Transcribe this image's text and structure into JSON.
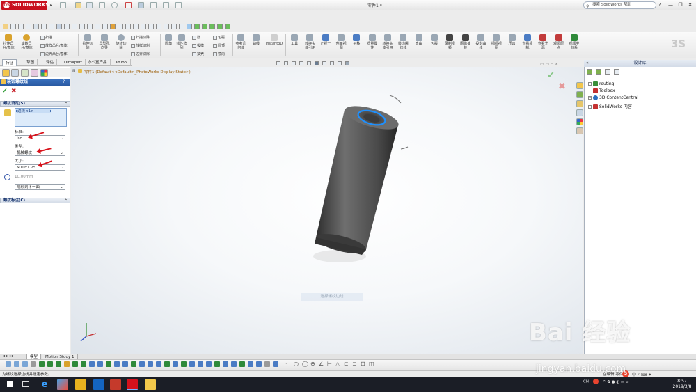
{
  "titlebar": {
    "app_logo": "SOLIDWORKS",
    "document_title": "零件1 *",
    "search_placeholder": "搜索 SolidWorks 帮助",
    "window_minimize": "—",
    "window_restore": "❐",
    "window_close": "✕"
  },
  "ribbon": {
    "group1": [
      {
        "label": "拉伸凸\n台/基体",
        "icon": "extrude-boss-icon",
        "color": "#d9a22c"
      },
      {
        "label": "旋转凸\n台/基体",
        "icon": "revolve-boss-icon",
        "color": "#d9a22c"
      }
    ],
    "group1_small": [
      "扫描",
      "放样凸台/基体",
      "边界凸台/基体"
    ],
    "group2": [
      {
        "label": "拉伸切\n除",
        "icon": "extrude-cut-icon",
        "color": "#9aa7b4"
      },
      {
        "label": "异型孔\n向导",
        "icon": "hole-wizard-icon",
        "color": "#9aa7b4"
      },
      {
        "label": "旋转切\n除",
        "icon": "revolve-cut-icon",
        "color": "#9aa7b4"
      }
    ],
    "group2_small": [
      "扫描切除",
      "放样切割",
      "边界切除"
    ],
    "group3": [
      {
        "label": "圆角",
        "icon": "fillet-icon",
        "color": "#9aa7b4"
      },
      {
        "label": "线性阵\n列",
        "icon": "linear-pattern-icon",
        "color": "#9aa7b4"
      }
    ],
    "group3_small": [
      "筋",
      "拔模",
      "抽壳",
      "包覆",
      "圆顶",
      "镜向"
    ],
    "group4": [
      {
        "label": "参考几\n何体",
        "icon": "reference-geometry-icon",
        "color": "#9aa7b4"
      },
      {
        "label": "曲线",
        "icon": "curves-icon",
        "color": "#9aa7b4"
      },
      {
        "label": "Instant3D",
        "icon": "instant3d-icon",
        "color": "#cfcfcf"
      }
    ],
    "group5": [
      {
        "label": "工具",
        "icon": "tools-icon",
        "color": "#9aa7b4"
      },
      {
        "label": "转换实\n体引用",
        "icon": "convert-entities-icon",
        "color": "#9aa7b4"
      },
      {
        "label": "正视于",
        "icon": "normal-to-icon",
        "color": "#4b7cc4"
      },
      {
        "label": "剖面视\n图",
        "icon": "section-view-icon",
        "color": "#9aa7b4"
      },
      {
        "label": "平移",
        "icon": "pan-icon",
        "color": "#4b7cc4"
      },
      {
        "label": "质量属\n性",
        "icon": "mass-properties-icon",
        "color": "#9aa7b4"
      },
      {
        "label": "转换实\n体引用",
        "icon": "convert-entities-2-icon",
        "color": "#9aa7b4"
      },
      {
        "label": "装饰螺\n纹线",
        "icon": "cosmetic-thread-icon",
        "color": "#9aa7b4"
      },
      {
        "label": "筒曲",
        "icon": "wrap-icon",
        "color": "#9aa7b4"
      },
      {
        "label": "包覆",
        "icon": "wrap-2-icon",
        "color": "#9aa7b4"
      },
      {
        "label": "录制视\n频",
        "icon": "record-video-icon",
        "color": "#444"
      },
      {
        "label": "图像捕\n获",
        "icon": "image-capture-icon",
        "color": "#444"
      },
      {
        "label": "投影曲\n线",
        "icon": "projected-curve-icon",
        "color": "#9aa7b4"
      },
      {
        "label": "相机视\n图",
        "icon": "camera-view-icon",
        "color": "#9aa7b4"
      },
      {
        "label": "压凹",
        "icon": "indent-icon",
        "color": "#9aa7b4"
      },
      {
        "label": "查看相\n机",
        "icon": "view-camera-icon",
        "color": "#4b7cc4"
      },
      {
        "label": "查看光\n源",
        "icon": "view-lights-icon",
        "color": "#c23b3b"
      },
      {
        "label": "观阅原\n点",
        "icon": "view-origins-icon",
        "color": "#c23b3b"
      },
      {
        "label": "观阅坐\n标系",
        "icon": "view-coordinate-icon",
        "color": "#2f8a3a"
      }
    ]
  },
  "tabs": [
    {
      "label": "特征",
      "active": true
    },
    {
      "label": "草图",
      "active": false
    },
    {
      "label": "评估",
      "active": false
    },
    {
      "label": "DimXpert",
      "active": false
    },
    {
      "label": "办公室产品",
      "active": false
    },
    {
      "label": "KYTool",
      "active": false
    }
  ],
  "property_manager": {
    "title": "装饰螺纹线",
    "ok": "✔",
    "cancel": "✖",
    "thread_settings": {
      "header": "螺纹设定(S)",
      "edge_item": "边线<1>",
      "standard_label": "标准:",
      "standard_value": "Iso",
      "type_label": "类型:",
      "type_value": "机械螺纹",
      "size_label": "大小:",
      "size_value": "M10x1.25",
      "depth_value": "10.00mm",
      "end_condition": "成形到下一面"
    },
    "thread_callout": {
      "header": "螺纹标注(C)"
    }
  },
  "viewport": {
    "breadcrumb": "零件1  (Default<<Default>_PhotoWorks Display State>)",
    "hint_text": "选择螺纹边线"
  },
  "design_library": {
    "header": "设计库",
    "items": [
      {
        "label": "routing",
        "icon_color": "#3a8f3a"
      },
      {
        "label": "Toolbox",
        "icon_color": "#c43131"
      },
      {
        "label": "3D ContentCentral",
        "icon_color": "#2c6fbf"
      },
      {
        "label": "SolidWorks 内容",
        "icon_color": "#c43131"
      }
    ]
  },
  "bottom_tabs": [
    {
      "label": "模型",
      "active": true
    },
    {
      "label": "Motion Study 1",
      "active": false
    }
  ],
  "statusbar": {
    "text": "为螺纹选择边线并设定参数。",
    "mode": "在编辑 零件"
  },
  "taskbar": {
    "tray_lang": "CH",
    "time": "8:57",
    "date": "2019/3/8"
  },
  "watermark": {
    "brand": "Bai 经验",
    "url": "jingyan.baidu.com"
  }
}
